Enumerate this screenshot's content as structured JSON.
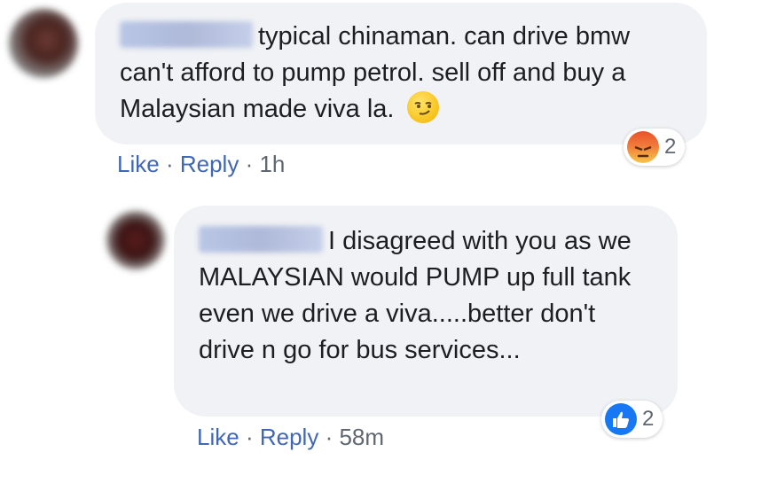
{
  "comments": [
    {
      "text": "typical chinaman. can drive bmw can't afford to pump petrol. sell off and buy a Malaysian made viva la.",
      "emoji": "smirk-emoji",
      "actions": {
        "like": "Like",
        "sep1": "·",
        "reply": "Reply",
        "sep2": "·",
        "time": "1h"
      },
      "reaction": {
        "icon": "angry-reaction-icon",
        "count": "2"
      }
    },
    {
      "text": "I disagreed with you as we MALAYSIAN would PUMP up full tank even we drive a viva.....better don't drive n go for bus services...",
      "actions": {
        "like": "Like",
        "sep1": "·",
        "reply": "Reply",
        "sep2": "·",
        "time": "58m"
      },
      "reaction": {
        "icon": "like-reaction-icon",
        "count": "2"
      }
    }
  ],
  "colors": {
    "bubble": "#f0f2f5",
    "link": "#4267b2",
    "meta": "#606770",
    "like_blue": "#1877f2"
  }
}
